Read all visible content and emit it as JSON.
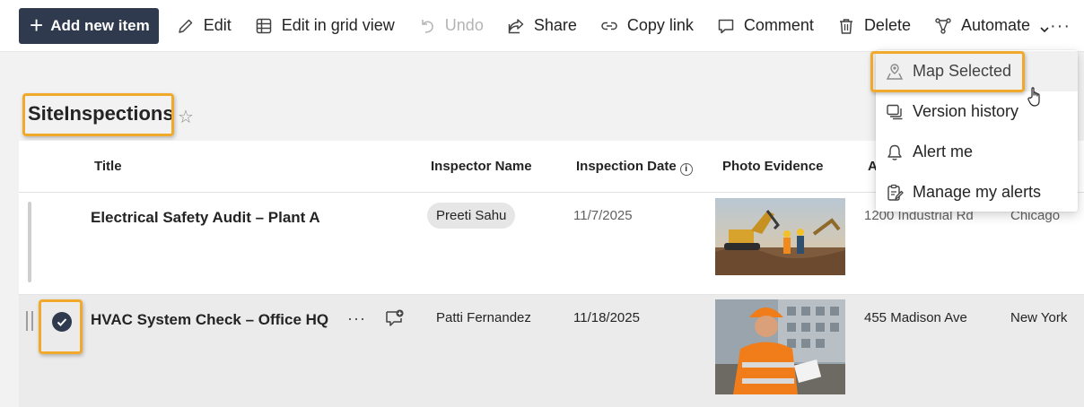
{
  "toolbar": {
    "add_label": "Add new item",
    "edit_label": "Edit",
    "grid_label": "Edit in grid view",
    "undo_label": "Undo",
    "share_label": "Share",
    "copy_label": "Copy link",
    "comment_label": "Comment",
    "delete_label": "Delete",
    "automate_label": "Automate",
    "more_label": "···"
  },
  "list": {
    "title": "SiteInspections",
    "columns": {
      "title": "Title",
      "inspector": "Inspector Name",
      "date": "Inspection Date",
      "photo": "Photo Evidence",
      "address": "A"
    },
    "rows": [
      {
        "title": "Electrical Safety Audit – Plant A",
        "inspector": "Preeti Sahu",
        "date": "11/7/2025",
        "address": "1200 Industrial Rd",
        "city": "Chicago",
        "photo_icon": "excavator-worker-photo"
      },
      {
        "title": "HVAC System Check – Office HQ",
        "inspector": "Patti Fernandez",
        "date": "11/18/2025",
        "address": "455 Madison Ave",
        "city": "New York",
        "photo_icon": "inspector-clipboard-photo",
        "more": "···"
      }
    ]
  },
  "menu": {
    "items": [
      {
        "label": "Map Selected",
        "icon": "map-pin-icon"
      },
      {
        "label": "Version history",
        "icon": "version-history-icon"
      },
      {
        "label": "Alert me",
        "icon": "bell-icon"
      },
      {
        "label": "Manage my alerts",
        "icon": "manage-alerts-icon"
      }
    ]
  },
  "colors": {
    "primary": "#2f3a4e",
    "highlight": "#f0a92b",
    "selected_row": "#ebebeb"
  }
}
